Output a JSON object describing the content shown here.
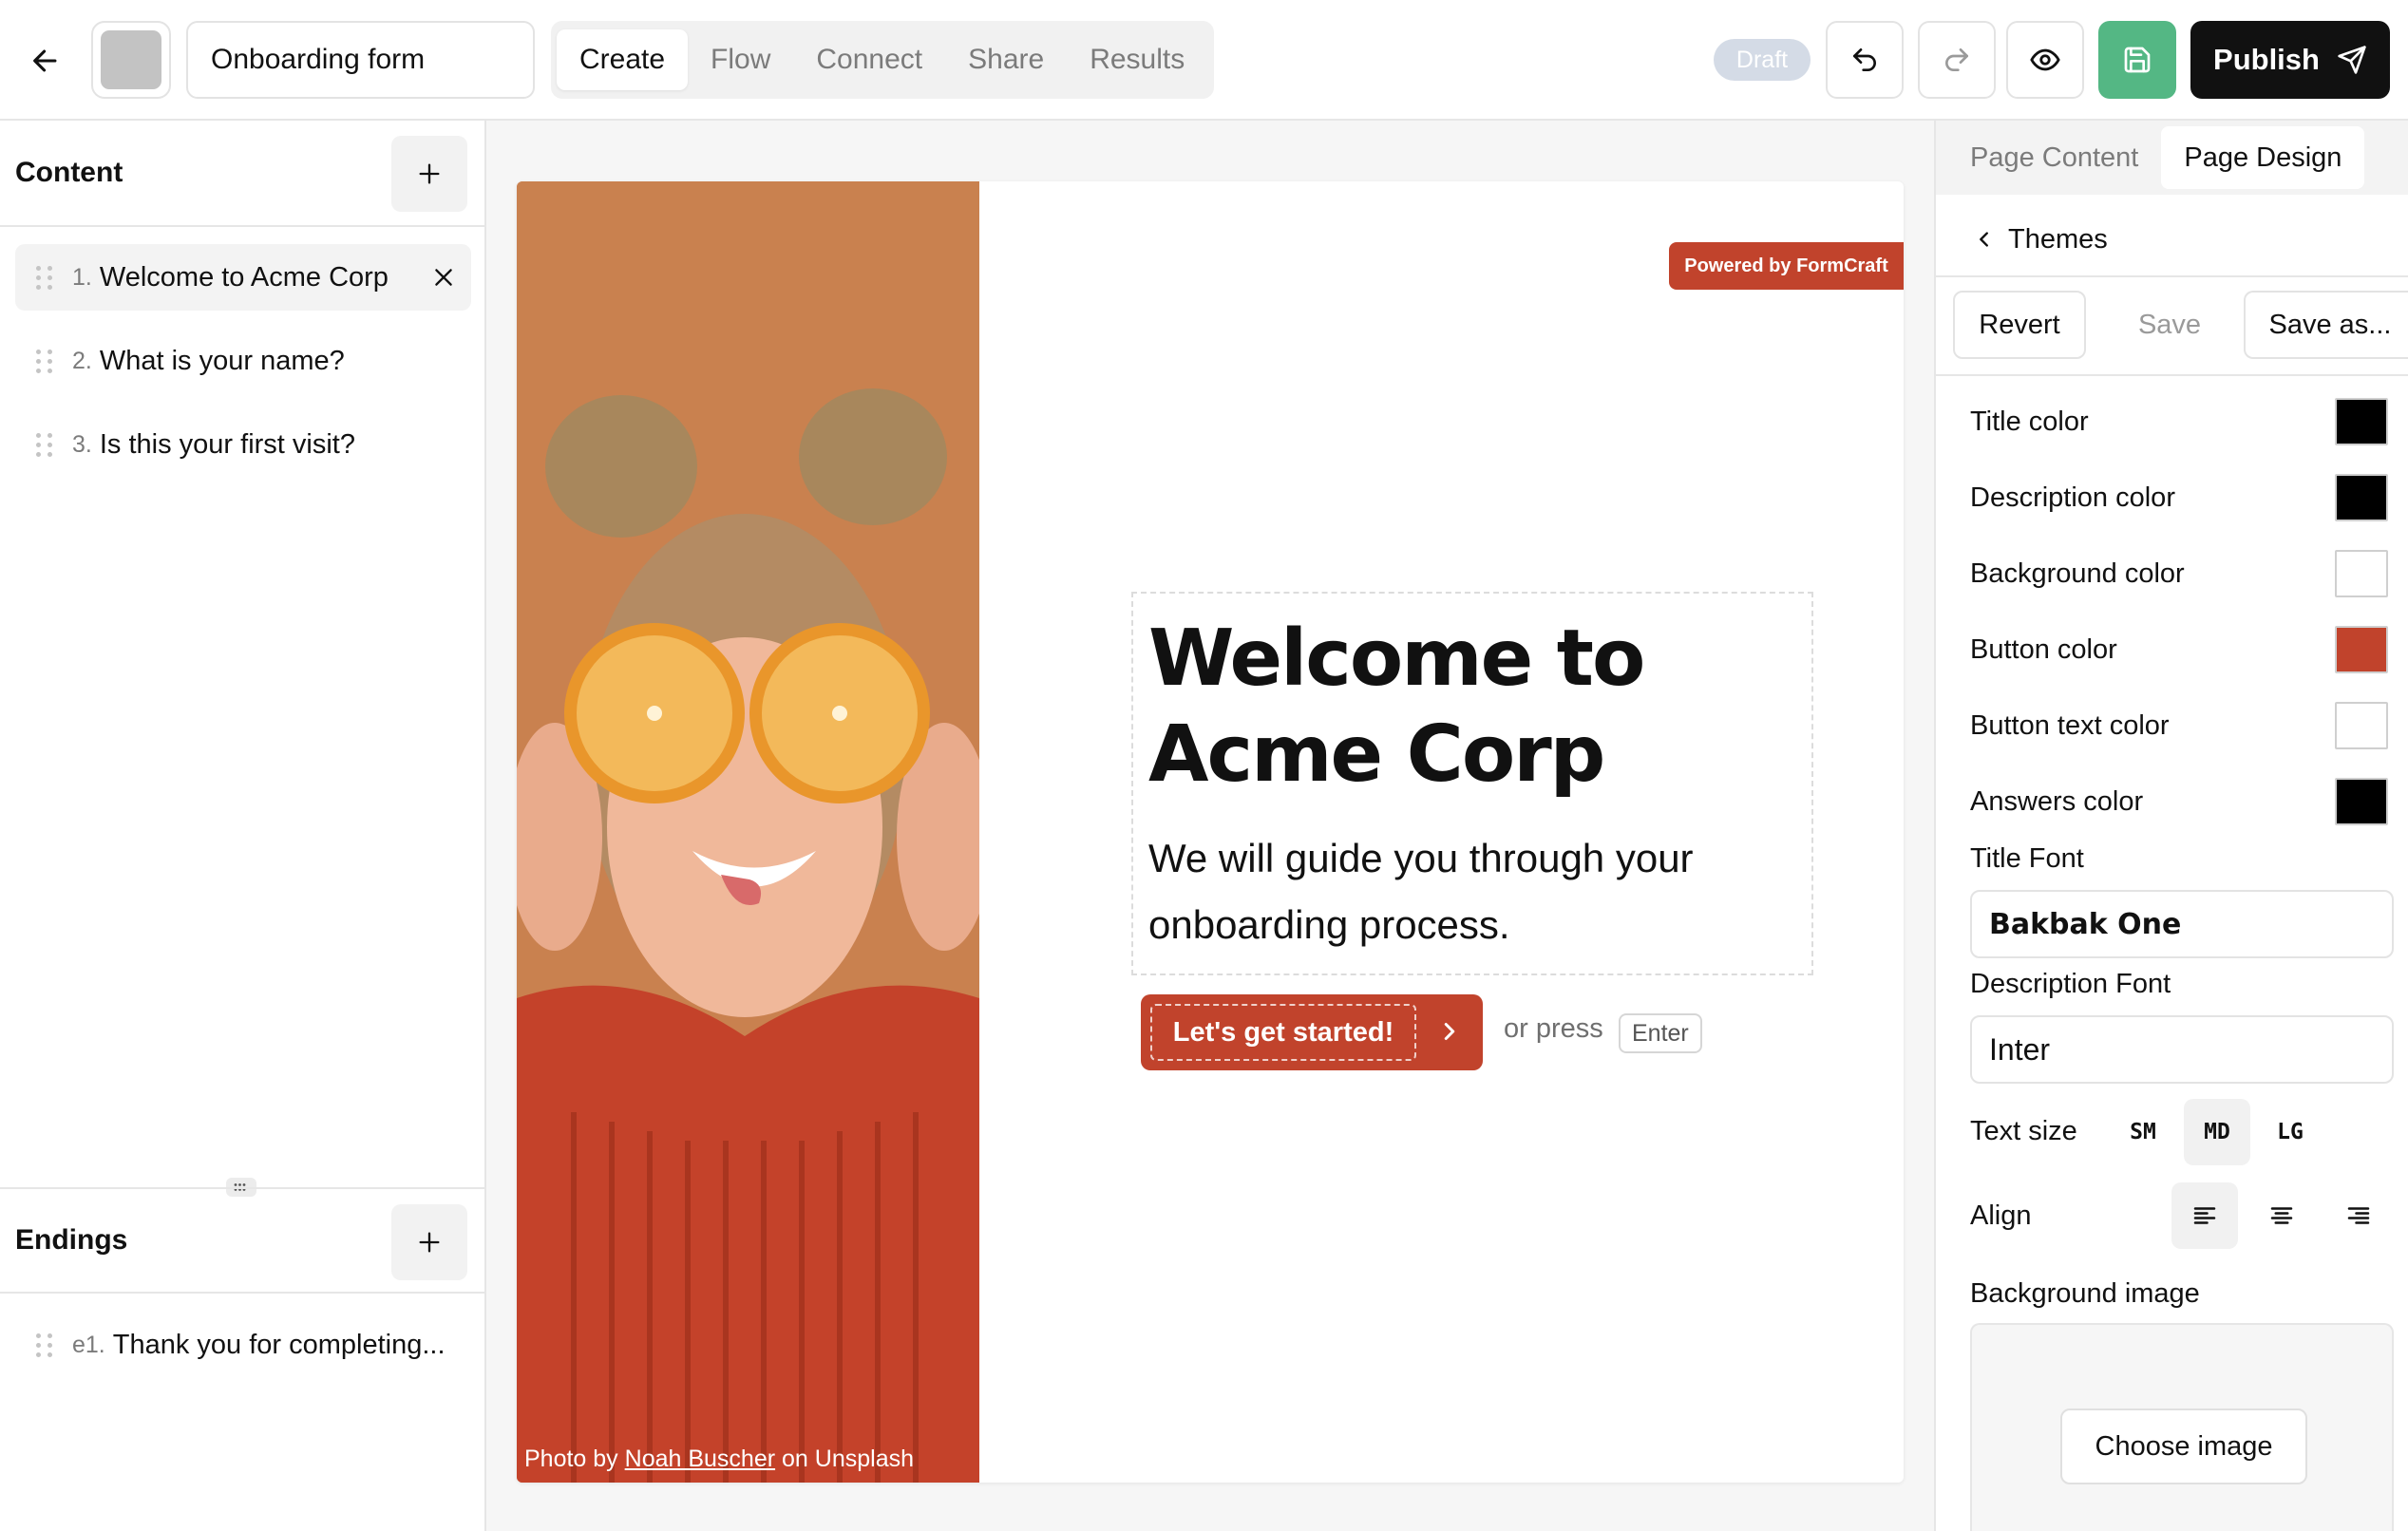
{
  "topbar": {
    "form_name": "Onboarding form",
    "tabs": [
      "Create",
      "Flow",
      "Connect",
      "Share",
      "Results"
    ],
    "active_tab": "Create",
    "status_badge": "Draft",
    "publish_label": "Publish"
  },
  "content": {
    "title": "Content",
    "questions": [
      {
        "num": "1.",
        "label": "Welcome to Acme Corp"
      },
      {
        "num": "2.",
        "label": "What is your name?"
      },
      {
        "num": "3.",
        "label": "Is this your first visit?"
      }
    ]
  },
  "endings": {
    "title": "Endings",
    "items": [
      {
        "num": "e1.",
        "label": "Thank you for completing..."
      }
    ]
  },
  "preview": {
    "powered_by": "Powered by FormCraft",
    "title": "Welcome to Acme Corp",
    "description": "We will guide you through your onboarding process.",
    "cta_label": "Let's get started!",
    "or_press": "or press",
    "enter_key": "Enter",
    "credit_prefix": "Photo by",
    "credit_author": "Noah Buscher",
    "credit_suffix": "on Unsplash"
  },
  "design_panel": {
    "tabs": [
      "Page Content",
      "Page Design"
    ],
    "active_tab": "Page Design",
    "themes_link": "Themes",
    "revert_label": "Revert",
    "save_label": "Save",
    "save_as_label": "Save as...",
    "colors": [
      {
        "label": "Title color",
        "value": "#000000"
      },
      {
        "label": "Description color",
        "value": "#000000"
      },
      {
        "label": "Background color",
        "value": "#ffffff"
      },
      {
        "label": "Button color",
        "value": "#c1432c"
      },
      {
        "label": "Button text color",
        "value": "#ffffff"
      },
      {
        "label": "Answers color",
        "value": "#000000"
      }
    ],
    "title_font_label": "Title Font",
    "title_font_value": "Bakbak One",
    "description_font_label": "Description Font",
    "description_font_value": "Inter",
    "text_size_label": "Text size",
    "text_sizes": [
      "SM",
      "MD",
      "LG"
    ],
    "active_text_size": "MD",
    "align_label": "Align",
    "background_image_label": "Background image",
    "choose_image_label": "Choose image"
  },
  "colors": {
    "accent": "#c1432c",
    "save_green": "#54b784",
    "draft_badge": "#d4dbe6"
  },
  "icons": [
    "arrow-left-icon",
    "undo-icon",
    "redo-icon",
    "eye-icon",
    "floppy-disk-icon",
    "send-icon",
    "plus-icon",
    "close-icon",
    "drag-handle-icon",
    "chevron-left-icon",
    "chevron-right-icon",
    "align-left-icon",
    "align-center-icon",
    "align-right-icon"
  ]
}
